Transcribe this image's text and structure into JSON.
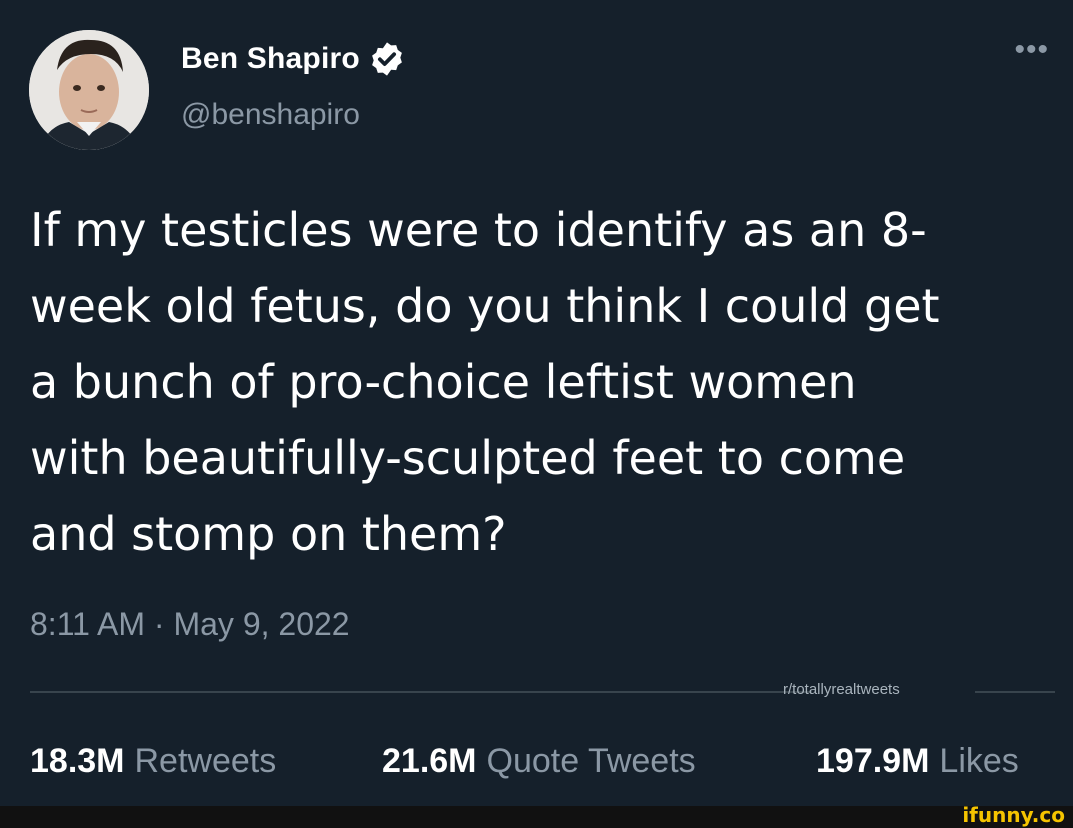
{
  "user": {
    "display_name": "Ben Shapiro",
    "handle": "@benshapiro",
    "verified": true
  },
  "menu": {
    "more_label": "•••"
  },
  "tweet": {
    "text": "If my testicles were to identify as an 8-\nweek old fetus, do you think I could get\na bunch of pro-choice leftist women\nwith beautifully-sculpted feet to come\nand stomp on them?",
    "timestamp": "8:11 AM · May 9, 2022"
  },
  "watermark": "r/totallyrealtweets",
  "stats": {
    "retweets": {
      "value": "18.3M",
      "label": "Retweets"
    },
    "quote_tweets": {
      "value": "21.6M",
      "label": "Quote Tweets"
    },
    "likes": {
      "value": "197.9M",
      "label": "Likes"
    }
  },
  "footer": {
    "brand": "ifunny.co"
  },
  "colors": {
    "background": "#15202b",
    "secondary_text": "#8b98a5",
    "verified_badge": "#ffffff",
    "brand_yellow": "#f5c400"
  }
}
